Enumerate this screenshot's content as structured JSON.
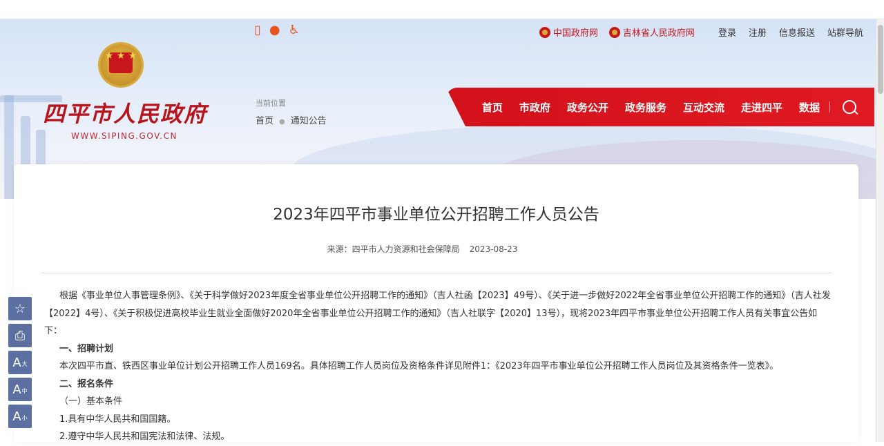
{
  "header": {
    "quick_icons": [
      "mobile-icon",
      "wechat-icon",
      "accessibility-icon"
    ],
    "toplinks": {
      "gov_links": [
        "中国政府网",
        "吉林省人民政府网"
      ],
      "plain": [
        "登录",
        "注册",
        "信息报送",
        "站群导航"
      ]
    },
    "logo": {
      "name": "四平市人民政府",
      "url": "WWW.SIPING.GOV.CN"
    },
    "breadcrumb": {
      "label": "当前位置",
      "home": "首页",
      "current": "通知公告"
    },
    "nav": [
      "首页",
      "市政府",
      "政务公开",
      "政务服务",
      "互动交流",
      "走进四平",
      "数据"
    ]
  },
  "article": {
    "title": "2023年四平市事业单位公开招聘工作人员公告",
    "source": "来源：四平市人力资源和社会保障局",
    "date": "2023-08-23",
    "intro": "根据《事业单位人事管理条例》、《关于科学做好2023年度全省事业单位公开招聘工作的通知》（吉人社函【2023】49号）、《关于进一步做好2022年全省事业单位公开招聘工作的通知》（吉人社发【2022】4号）、《关于积极促进高校毕业生就业全面做好2020年全省事业单位公开招聘工作的通知》（吉人社联字【2020】13号），现将2023年四平市事业单位公开招聘工作人员有关事宜公告如下：",
    "s1_heading": "一、招聘计划",
    "s1_text": "本次四平市直、铁西区事业单位计划公开招聘工作人员169名。具体招聘工作人员岗位及资格条件详见附件1：《2023年四平市事业单位公开招聘工作人员岗位及其资格条件一览表》。",
    "s2_heading": "二、报名条件",
    "s2_sub": "（一）基本条件",
    "s2_item1": "1.具有中华人民共和国国籍。",
    "s2_item2": "2.遵守中华人民共和国宪法和法律、法规。"
  },
  "sidetools": {
    "icons": [
      "star-icon",
      "print-icon",
      "font-large-icon",
      "font-medium-icon",
      "font-small-icon"
    ],
    "labels": [
      "大",
      "中",
      "小"
    ]
  },
  "colors": {
    "brand_red": "#d3111b",
    "tool_blue": "#5b6fa1"
  }
}
